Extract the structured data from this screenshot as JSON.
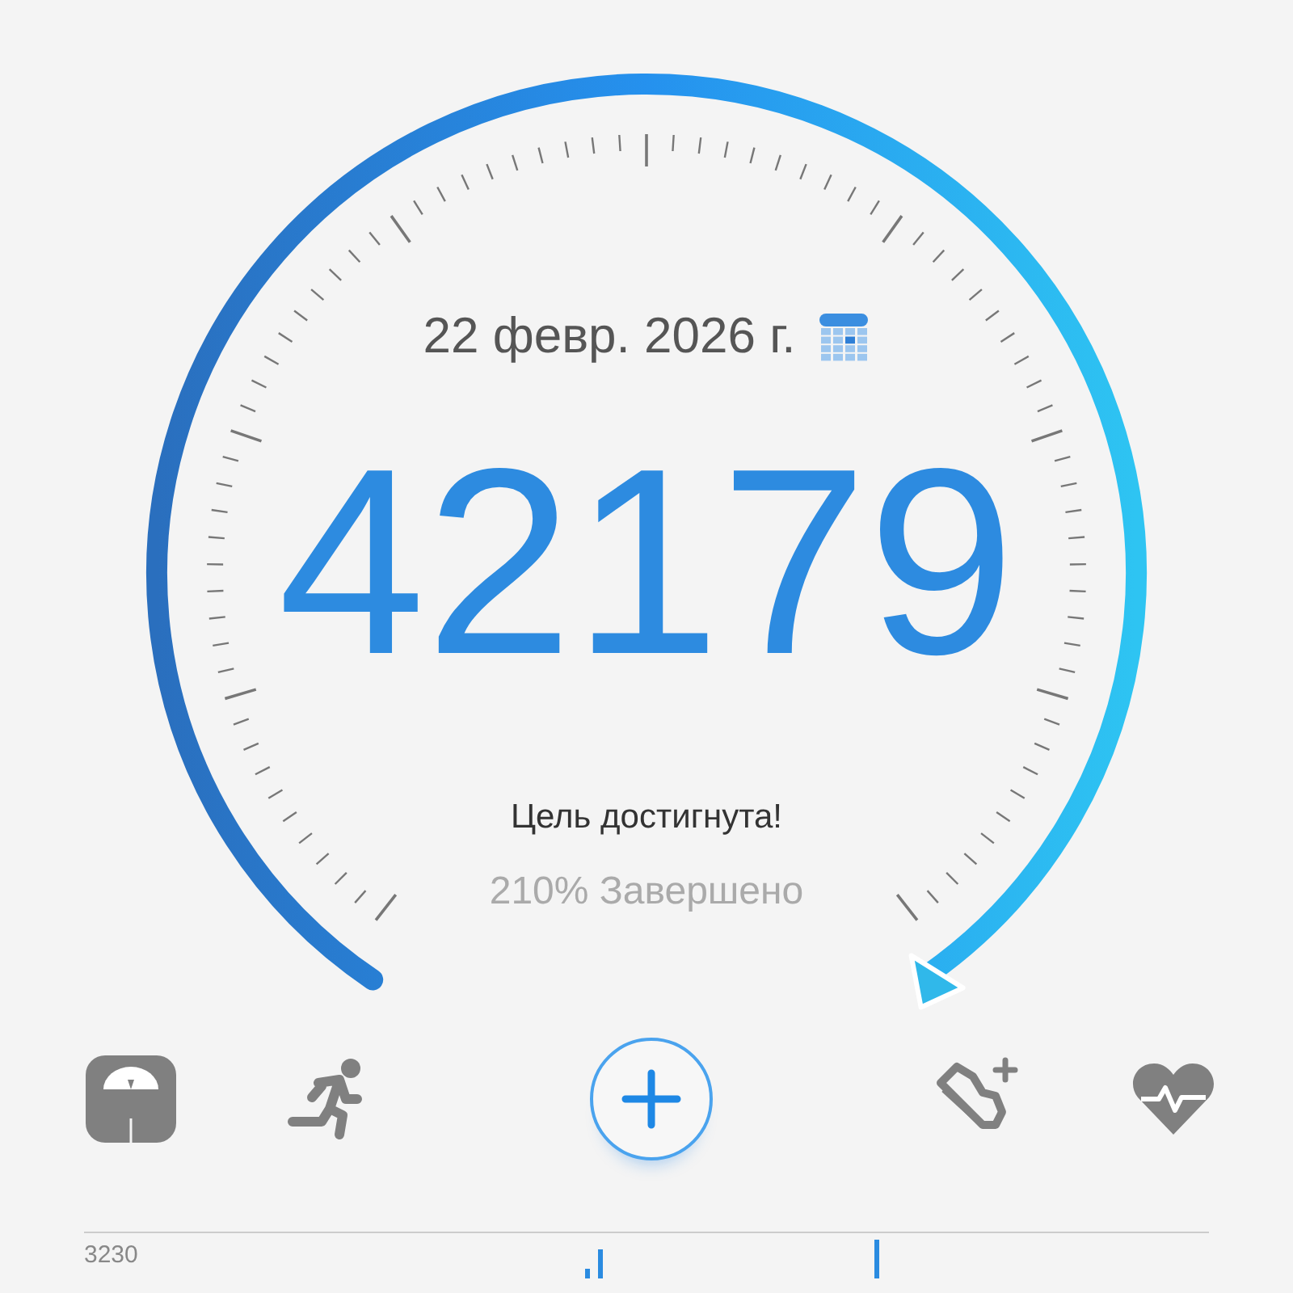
{
  "date": "22 февр. 2026 г.",
  "steps": "42179",
  "goal_status": "Цель достигнута!",
  "completion": "210% Завершено",
  "nav": [
    {
      "kind": "scale"
    },
    {
      "kind": "run"
    },
    {
      "kind": "add"
    },
    {
      "kind": "shoe"
    },
    {
      "kind": "heart"
    }
  ],
  "chart": {
    "axis_label": "3230"
  }
}
